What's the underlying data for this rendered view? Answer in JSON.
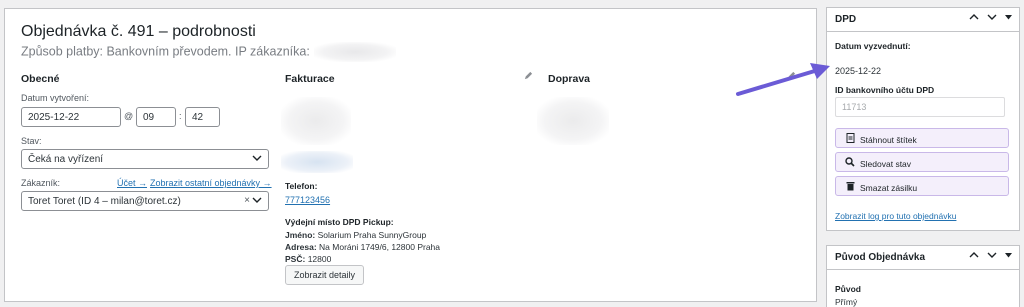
{
  "order": {
    "title": "Objednávka č. 491 – podrobnosti",
    "subtitle": "Způsob platby: Bankovním převodem. IP zákazníka:"
  },
  "general": {
    "heading": "Obecné",
    "created_label": "Datum vytvoření:",
    "created_date": "2025-12-22",
    "at_symbol": "@",
    "hour": "09",
    "time_sep": ":",
    "minute": "42",
    "status_label": "Stav:",
    "status_value": "Čeká na vyřízení",
    "customer_label": "Zákazník:",
    "account_link": "Účet →",
    "other_orders_link": "Zobrazit ostatní objednávky →",
    "customer_value": "Toret Toret (ID 4 – milan@toret.cz)",
    "clear_symbol": "×"
  },
  "billing": {
    "heading": "Fakturace",
    "phone_label": "Telefon:",
    "phone_value": "777123456",
    "pickup_heading": "Výdejní místo DPD Pickup:",
    "name_key": "Jméno:",
    "name_value": "Solarium Praha SunnyGroup",
    "address_key": "Adresa:",
    "address_value": "Na Moráni 1749/6, 12800 Praha",
    "zip_key": "PSČ:",
    "zip_value": "12800",
    "details_button": "Zobrazit detaily"
  },
  "shipping": {
    "heading": "Doprava"
  },
  "dpd_box": {
    "title": "DPD",
    "pickup_date_label": "Datum vyzvednutí:",
    "pickup_date_value": "2025-12-22",
    "bank_id_label": "ID bankovního účtu DPD",
    "bank_id_placeholder": "11713",
    "download_label": "Stáhnout štítek",
    "track_label": "Sledovat stav",
    "delete_label": "Smazat zásilku",
    "log_link": "Zobrazit log pro tuto objednávku"
  },
  "origin_box": {
    "title": "Původ Objednávka",
    "origin_label": "Původ",
    "origin_value": "Přímý"
  },
  "colors": {
    "accent_link": "#2271b1",
    "button_purple_bg": "#f4effb",
    "button_purple_border": "#c9b8e8",
    "arrow": "#6b5bd6"
  },
  "icons": {
    "edit": "pencil-icon",
    "collapse_up": "chevron-up-icon",
    "collapse_down": "chevron-down-icon",
    "toggle": "triangle-down-icon",
    "download": "document-icon",
    "track": "magnifier-icon",
    "delete": "trash-icon"
  }
}
